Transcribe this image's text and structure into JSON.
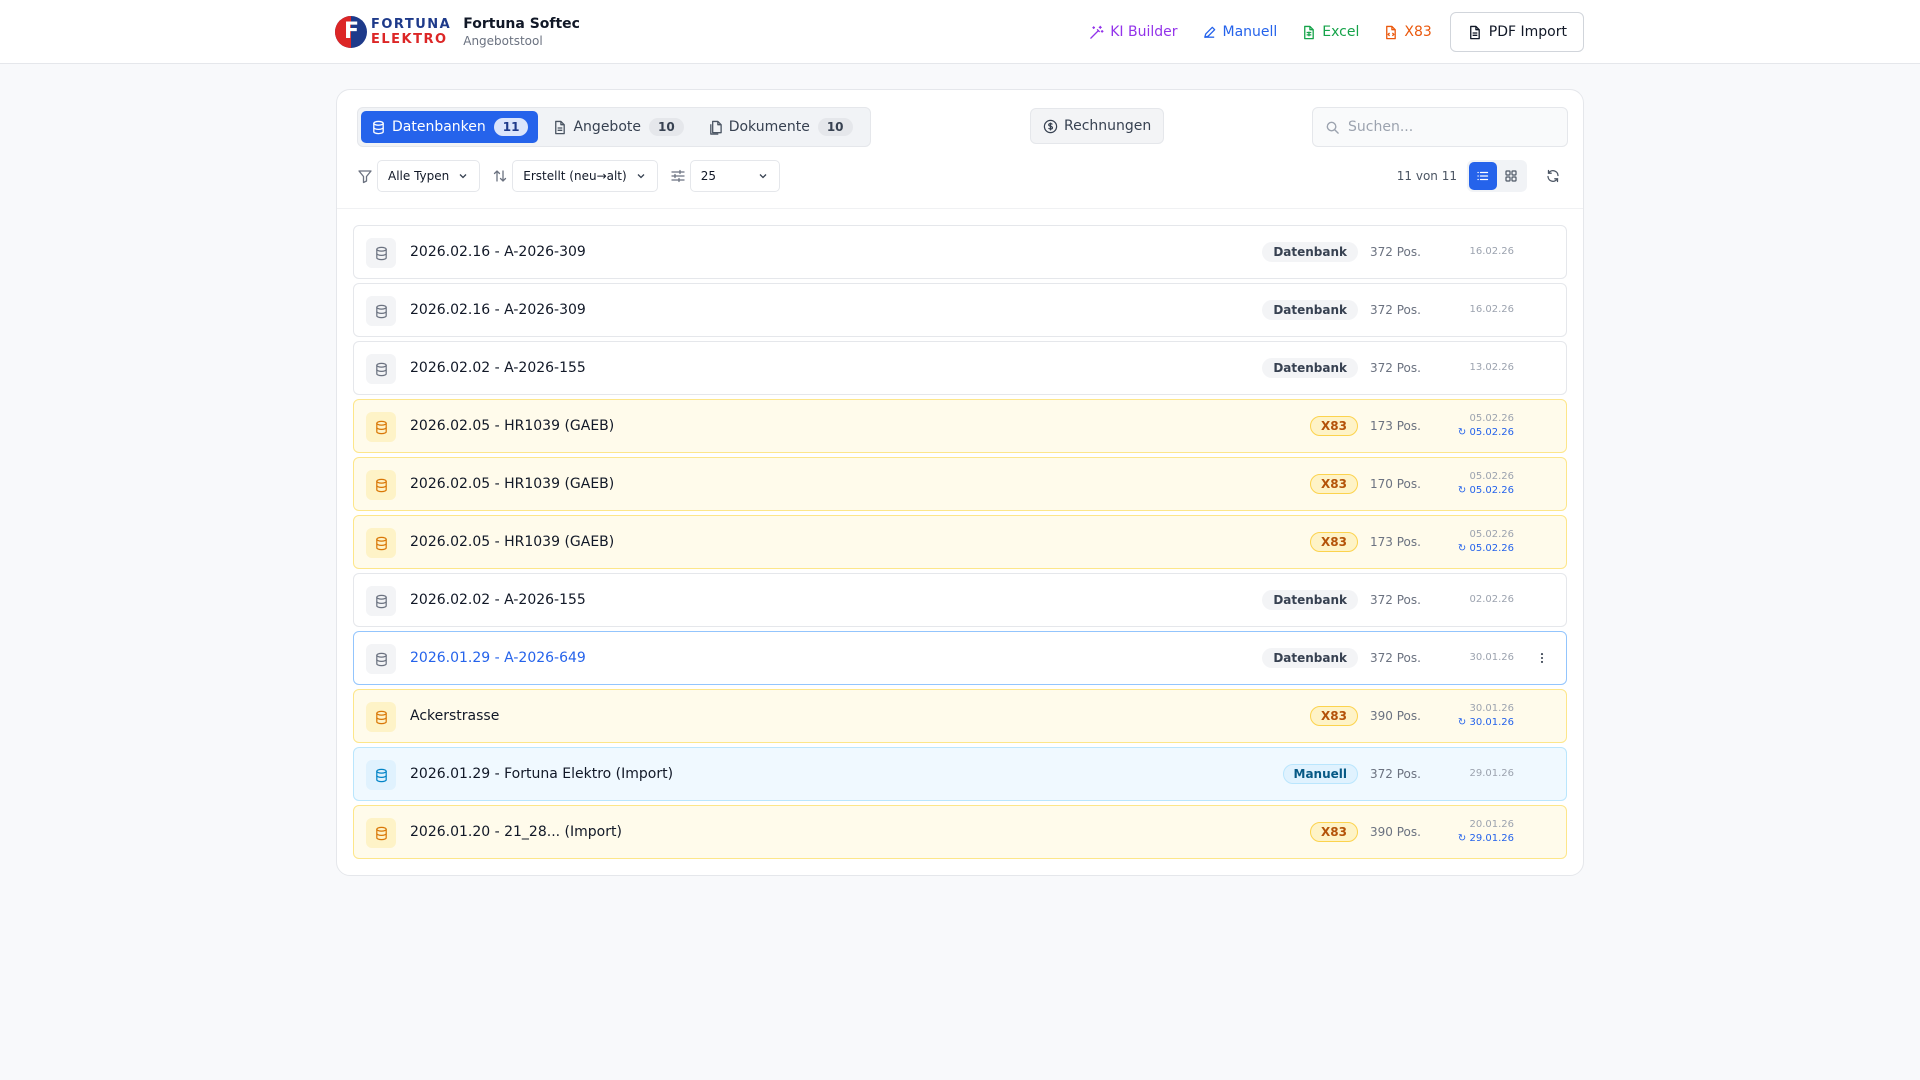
{
  "brand": {
    "logo_line1": "FORTUNA",
    "logo_line2": "ELEKTRO",
    "app_title": "Fortuna Softec",
    "app_subtitle": "Angebotstool"
  },
  "header_nav": {
    "ki_builder": "KI Builder",
    "manuell": "Manuell",
    "excel": "Excel",
    "x83": "X83",
    "pdf_import": "PDF Import",
    "colors": {
      "ki_builder": "#9333ea",
      "manuell": "#2563eb",
      "excel": "#16a34a",
      "x83": "#ea580c"
    }
  },
  "tabs": [
    {
      "label": "Datenbanken",
      "count": "11",
      "icon": "database-icon",
      "active": true
    },
    {
      "label": "Angebote",
      "count": "10",
      "icon": "document-icon",
      "active": false
    },
    {
      "label": "Dokumente",
      "count": "10",
      "icon": "files-icon",
      "active": false
    }
  ],
  "rechnungen_label": "Rechnungen",
  "search": {
    "placeholder": "Suchen..."
  },
  "filters": {
    "type": "Alle Typen",
    "sort": "Erstellt (neu→alt)",
    "page_size": "25"
  },
  "result_count": "11 von 11",
  "rows": [
    {
      "title": "2026.02.16 - A-2026-309",
      "badge": "Datenbank",
      "kind": "db",
      "pos": "372 Pos.",
      "created": "16.02.26",
      "updated": ""
    },
    {
      "title": "2026.02.16 - A-2026-309",
      "badge": "Datenbank",
      "kind": "db",
      "pos": "372 Pos.",
      "created": "16.02.26",
      "updated": ""
    },
    {
      "title": "2026.02.02 - A-2026-155",
      "badge": "Datenbank",
      "kind": "db",
      "pos": "372 Pos.",
      "created": "13.02.26",
      "updated": ""
    },
    {
      "title": "2026.02.05 - HR1039 (GAEB)",
      "badge": "X83",
      "kind": "x83",
      "pos": "173 Pos.",
      "created": "05.02.26",
      "updated": "↻ 05.02.26"
    },
    {
      "title": "2026.02.05 - HR1039 (GAEB)",
      "badge": "X83",
      "kind": "x83",
      "pos": "170 Pos.",
      "created": "05.02.26",
      "updated": "↻ 05.02.26"
    },
    {
      "title": "2026.02.05 - HR1039 (GAEB)",
      "badge": "X83",
      "kind": "x83",
      "pos": "173 Pos.",
      "created": "05.02.26",
      "updated": "↻ 05.02.26"
    },
    {
      "title": "2026.02.02 - A-2026-155",
      "badge": "Datenbank",
      "kind": "db",
      "pos": "372 Pos.",
      "created": "02.02.26",
      "updated": ""
    },
    {
      "title": "2026.01.29 - A-2026-649",
      "badge": "Datenbank",
      "kind": "db",
      "pos": "372 Pos.",
      "created": "30.01.26",
      "updated": "",
      "selected": true
    },
    {
      "title": "Ackerstrasse",
      "badge": "X83",
      "kind": "x83",
      "pos": "390 Pos.",
      "created": "30.01.26",
      "updated": "↻ 30.01.26"
    },
    {
      "title": "2026.01.29 - Fortuna Elektro (Import)",
      "badge": "Manuell",
      "kind": "manuell",
      "pos": "372 Pos.",
      "created": "29.01.26",
      "updated": ""
    },
    {
      "title": "2026.01.20 - 21_28... (Import)",
      "badge": "X83",
      "kind": "x83",
      "pos": "390 Pos.",
      "created": "20.01.26",
      "updated": "↻ 29.01.26"
    }
  ]
}
